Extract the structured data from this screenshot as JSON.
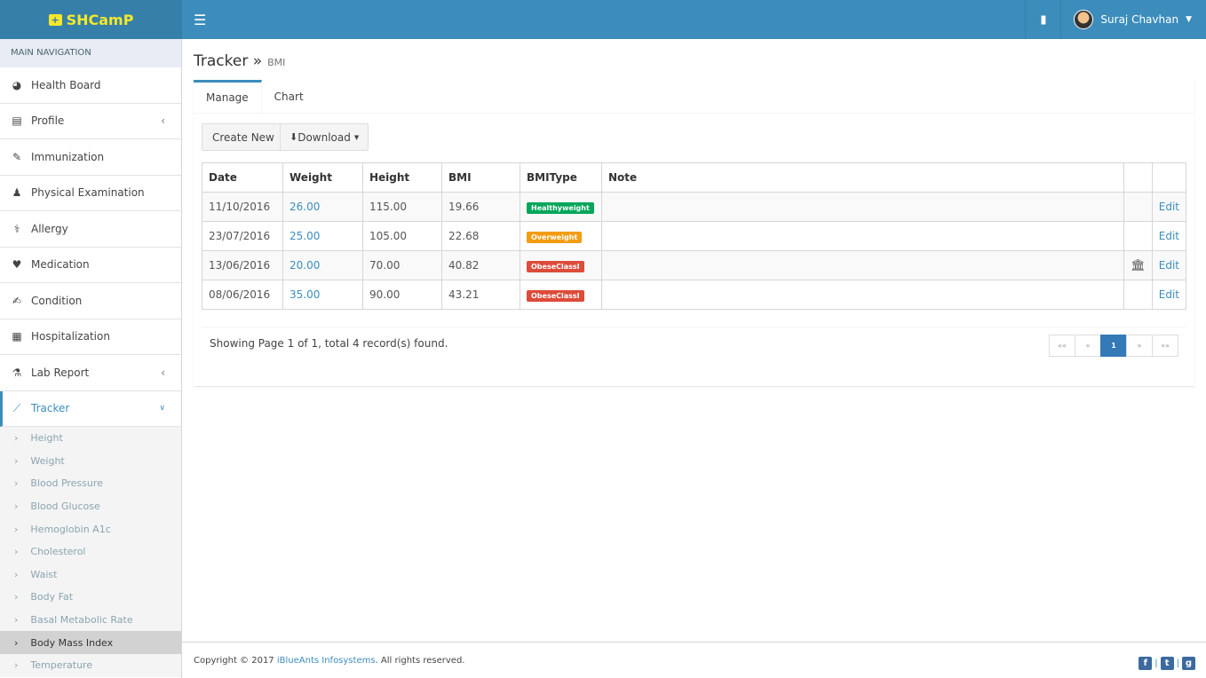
{
  "header": {
    "logo": "SHCamP",
    "user": "Suraj Chavhan"
  },
  "sidebar": {
    "heading": "MAIN NAVIGATION",
    "items": [
      {
        "label": "Health Board",
        "icon": "dashboard-icon"
      },
      {
        "label": "Profile",
        "icon": "file-icon"
      },
      {
        "label": "Immunization",
        "icon": "syringe-icon"
      },
      {
        "label": "Physical Examination",
        "icon": "user-md-icon"
      },
      {
        "label": "Allergy",
        "icon": "allergy-icon"
      },
      {
        "label": "Medication",
        "icon": "heartbeat-icon"
      },
      {
        "label": "Condition",
        "icon": "edit-icon"
      },
      {
        "label": "Hospitalization",
        "icon": "hospital-icon"
      },
      {
        "label": "Lab Report",
        "icon": "flask-icon"
      },
      {
        "label": "Tracker",
        "icon": "line-chart-icon"
      }
    ],
    "tracker_sub": [
      "Height",
      "Weight",
      "Blood Pressure",
      "Blood Glucose",
      "Hemoglobin A1c",
      "Cholesterol",
      "Waist",
      "Body Fat",
      "Basal Metabolic Rate",
      "Body Mass Index",
      "Temperature"
    ]
  },
  "page": {
    "title": "Tracker",
    "sep": "»",
    "subtitle": "BMI"
  },
  "tabs": [
    "Manage",
    "Chart"
  ],
  "toolbar": {
    "create": "Create New",
    "download": "Download"
  },
  "table": {
    "headers": [
      "Date",
      "Weight",
      "Height",
      "BMI",
      "BMIType",
      "Note"
    ],
    "rows": [
      {
        "date": "11/10/2016",
        "weight": "26.00",
        "height": "115.00",
        "bmi": "19.66",
        "type": "Healthyweight",
        "color": "#00a65a",
        "action": "Edit"
      },
      {
        "date": "23/07/2016",
        "weight": "25.00",
        "height": "105.00",
        "bmi": "22.68",
        "type": "Overweight",
        "color": "#f39c12",
        "action": "Edit"
      },
      {
        "date": "13/06/2016",
        "weight": "20.00",
        "height": "70.00",
        "bmi": "40.82",
        "type": "ObeseClassI",
        "color": "#dd4b39",
        "action": "Edit"
      },
      {
        "date": "08/06/2016",
        "weight": "35.00",
        "height": "90.00",
        "bmi": "43.21",
        "type": "ObeseClassI",
        "color": "#dd4b39",
        "action": "Edit"
      }
    ]
  },
  "pagination": {
    "info": "Showing Page 1 of 1, total 4 record(s) found.",
    "pages": [
      "««",
      "«",
      "1",
      "»",
      "»»"
    ],
    "current": "1"
  },
  "footer": {
    "pre": "Copyright © 2017 ",
    "company": "iBlueAnts Infosystems",
    "post": ". All rights reserved."
  }
}
